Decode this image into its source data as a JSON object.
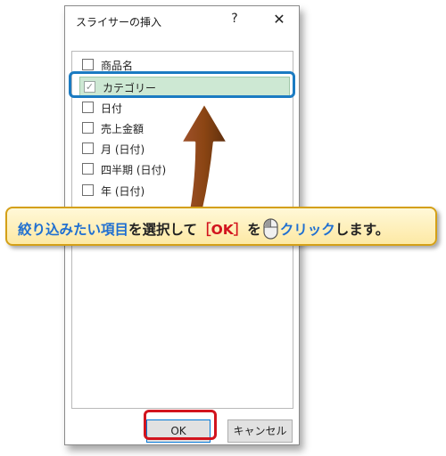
{
  "dialog": {
    "title": "スライサーの挿入",
    "help_label": "?",
    "close_label": "✕",
    "items": [
      {
        "label": "商品名",
        "checked": false
      },
      {
        "label": "カテゴリー",
        "checked": true
      },
      {
        "label": "日付",
        "checked": false
      },
      {
        "label": "売上金額",
        "checked": false
      },
      {
        "label": "月 (日付)",
        "checked": false
      },
      {
        "label": "四半期 (日付)",
        "checked": false
      },
      {
        "label": "年 (日付)",
        "checked": false
      }
    ],
    "ok_label": "OK",
    "cancel_label": "キャンセル"
  },
  "callout": {
    "part1": "絞り込みたい項目",
    "part2": "を選択して",
    "part3": "［OK］",
    "part4": "を",
    "part5": "クリック",
    "part6": "します。"
  },
  "colors": {
    "highlight_blue": "#1b7bc2",
    "ok_ring_red": "#d2141e",
    "arrow_brown": "#8b4513",
    "callout_bg": "#fde9a4",
    "callout_border": "#d4a017",
    "selected_row": "#cde8d3"
  },
  "icons": {
    "checkbox_checked": "checkmark",
    "mouse": "mouse-left-click-icon",
    "arrow": "up-arrow-pointer"
  }
}
